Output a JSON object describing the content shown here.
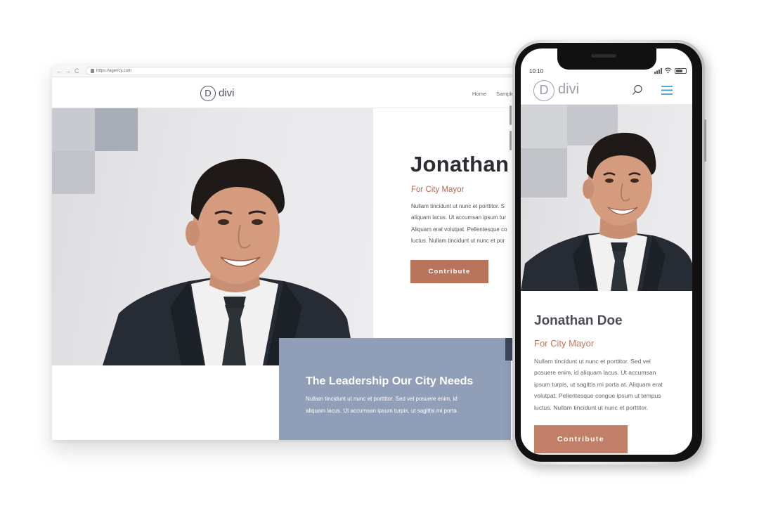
{
  "desktop": {
    "browser": {
      "nav_back": "←",
      "nav_forward": "→",
      "nav_reload": "C",
      "url": "https://agency.com"
    },
    "header": {
      "logo_mark": "D",
      "logo_text": "divi",
      "menu_items": [
        "Home",
        "Sample"
      ]
    },
    "hero": {
      "title": "Jonathan",
      "subtitle": "For City Mayor",
      "body": "Nullam tincidunt ut nunc et porttitor. S\naliquam lacus. Ut accumsan ipsum tur\nAliquam erat volutpat. Pellentesque co\nluctus. Nullam tincidunt ut nunc et por",
      "button_label": "Contribute"
    },
    "leadership": {
      "title": "The Leadership Our City Needs",
      "body": "Nullam tincidunt ut nunc et porttitor. Sed vel posuere enim, id\naliquam lacus. Ut accumsan ipsum turpis, ut sagittis mi porta"
    }
  },
  "phone": {
    "status": {
      "time": "10:10"
    },
    "header": {
      "logo_mark": "D",
      "logo_text": "divi"
    },
    "hero": {
      "title": "Jonathan Doe",
      "subtitle": "For City Mayor",
      "body": "Nullam tincidunt ut nunc et porttitor. Sed vel\nposuere enim, id aliquam lacus. Ut accumsan\nipsum turpis, ut sagittis mi porta at. Aliquam erat\nvolutpat. Pellentesque congue ipsum ut tempus\nluctus. Nullam tincidunt ut nunc et porttitor.",
      "button_label": "Contribute"
    }
  },
  "colors": {
    "accent": "#b8735b",
    "subtitle": "#b8694f",
    "panel_blue": "#909fb7",
    "heading_dark": "#2b2d33"
  },
  "icons": [
    "lock-icon",
    "search-icon",
    "hamburger-menu-icon",
    "signal-icon",
    "wifi-icon",
    "battery-icon"
  ]
}
